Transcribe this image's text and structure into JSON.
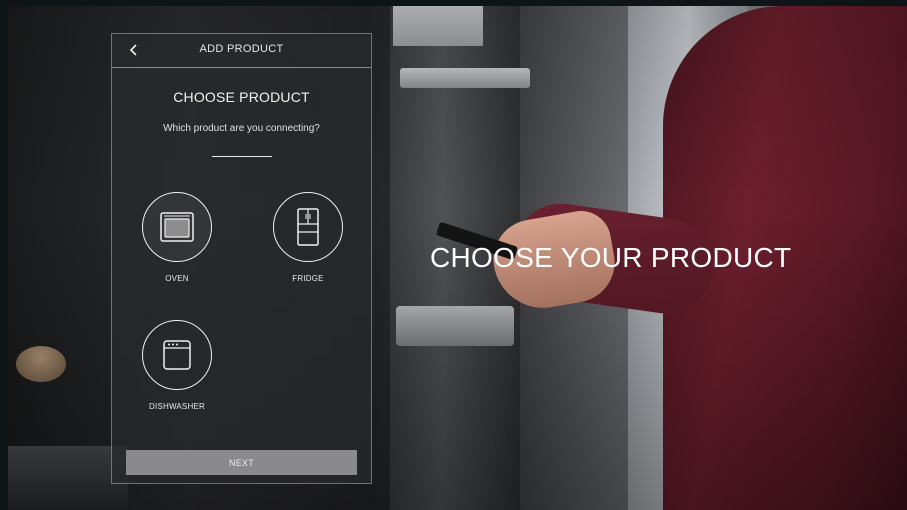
{
  "header": {
    "title": "ADD PRODUCT",
    "back_icon": "chevron-left-icon"
  },
  "main": {
    "title": "CHOOSE PRODUCT",
    "subtitle": "Which product are you connecting?",
    "products": [
      {
        "label": "OVEN",
        "icon": "oven-icon",
        "selected": true
      },
      {
        "label": "FRIDGE",
        "icon": "fridge-icon",
        "selected": false
      },
      {
        "label": "DISHWASHER",
        "icon": "dishwasher-icon",
        "selected": false
      }
    ],
    "next_label": "NEXT"
  },
  "overlay": {
    "headline": "CHOOSE YOUR PRODUCT"
  },
  "colors": {
    "panel_bg": "#28292b",
    "button_bg": "#8a8a8c",
    "text": "#e6e6e6"
  }
}
